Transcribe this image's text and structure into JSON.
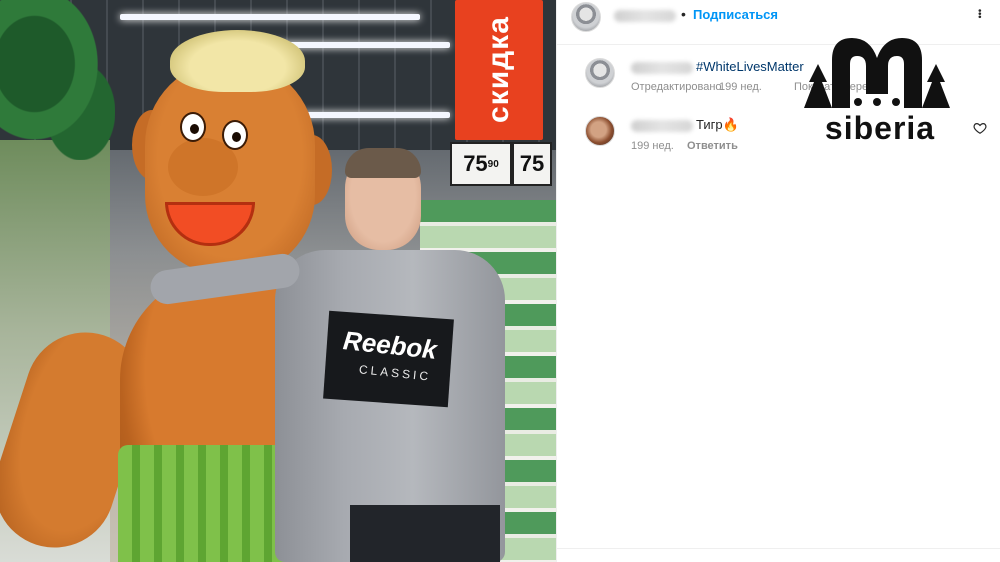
{
  "photo": {
    "promo_sign_text": "скидка",
    "price_main": "75",
    "price_cents": "90",
    "price_side": "75",
    "shirt_logo_text": "Reebok",
    "shirt_logo_sub": "CLASSIC"
  },
  "post_header": {
    "username_blurred": "",
    "separator": "•",
    "follow_label": "Подписаться",
    "more_label": "•••"
  },
  "caption": {
    "text": "#WhiteLivesMatter",
    "edited_label": "Отредактировано",
    "age": "199 нед.",
    "translate_label": "Показать перевод"
  },
  "comment": {
    "text": "Тигр🔥",
    "age": "199 нед.",
    "reply_label": "Ответить"
  },
  "watermark": {
    "text": "siberia",
    "icon": "m-mountains-logo"
  },
  "colors": {
    "follow_blue": "#0095f6",
    "hashtag_blue": "#00376b",
    "meta_gray": "#8e8e8e",
    "promo_red": "#e8411f"
  }
}
